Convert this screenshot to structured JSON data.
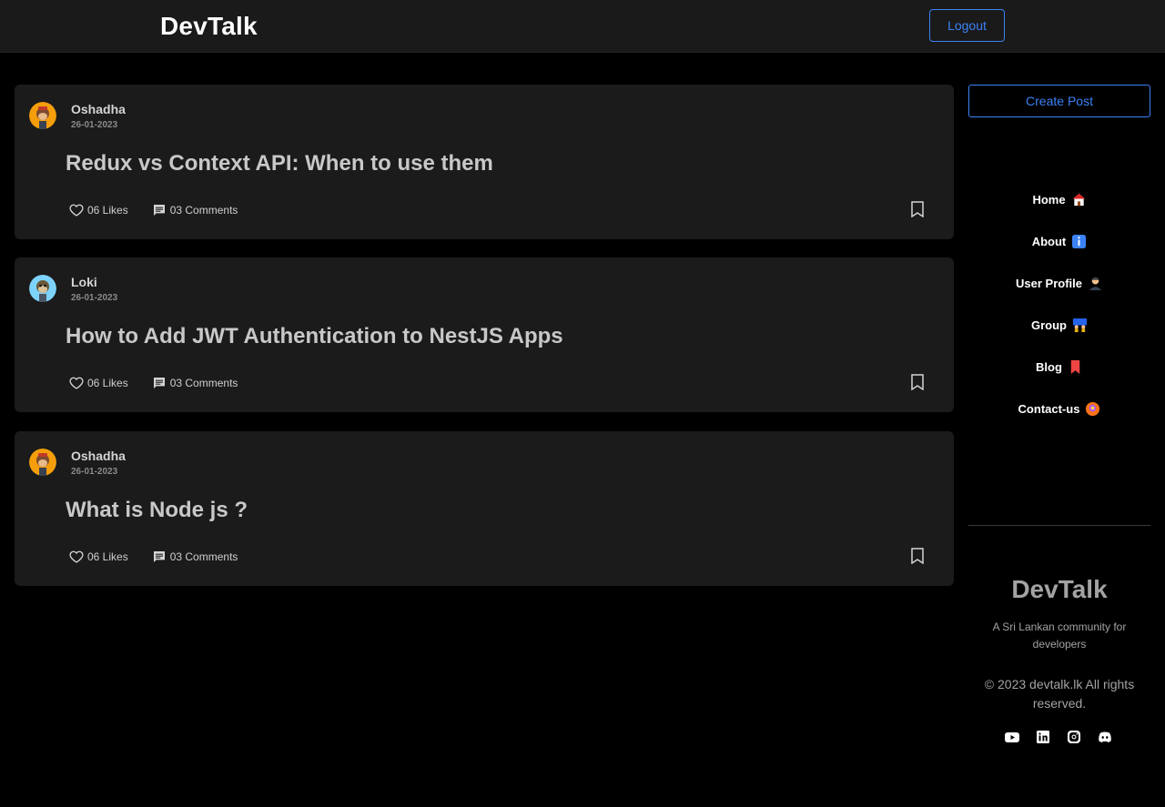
{
  "header": {
    "brand": "DevTalk",
    "logout_label": "Logout"
  },
  "posts": [
    {
      "author": "Oshadha",
      "date": "26-01-2023",
      "title": "Redux vs Context API: When to use them",
      "likes": "06 Likes",
      "comments": "03 Comments",
      "avatar_icon": "monkey-avatar-orange"
    },
    {
      "author": "Loki",
      "date": "26-01-2023",
      "title": "How to Add JWT Authentication to NestJS Apps",
      "likes": "06 Likes",
      "comments": "03 Comments",
      "avatar_icon": "monkey-avatar-blue"
    },
    {
      "author": "Oshadha",
      "date": "26-01-2023",
      "title": "What is Node js ?",
      "likes": "06 Likes",
      "comments": "03 Comments",
      "avatar_icon": "monkey-avatar-orange"
    }
  ],
  "sidebar": {
    "create_label": "Create Post",
    "nav": [
      {
        "label": "Home",
        "icon": "house-icon"
      },
      {
        "label": "About",
        "icon": "info-icon"
      },
      {
        "label": "User Profile",
        "icon": "person-icon"
      },
      {
        "label": "Group",
        "icon": "group-icon"
      },
      {
        "label": "Blog",
        "icon": "bookmark-red-icon"
      },
      {
        "label": "Contact-us",
        "icon": "support-icon"
      }
    ]
  },
  "footer": {
    "brand": "DevTalk",
    "tagline": "A Sri Lankan community for developers",
    "copyright": "© 2023 devtalk.lk All rights reserved.",
    "social": [
      "youtube-icon",
      "linkedin-icon",
      "instagram-icon",
      "discord-icon"
    ]
  },
  "colors": {
    "accent": "#3b82f6",
    "background": "#000000",
    "card": "#1b1b1b",
    "topbar": "#1a1a1a"
  }
}
